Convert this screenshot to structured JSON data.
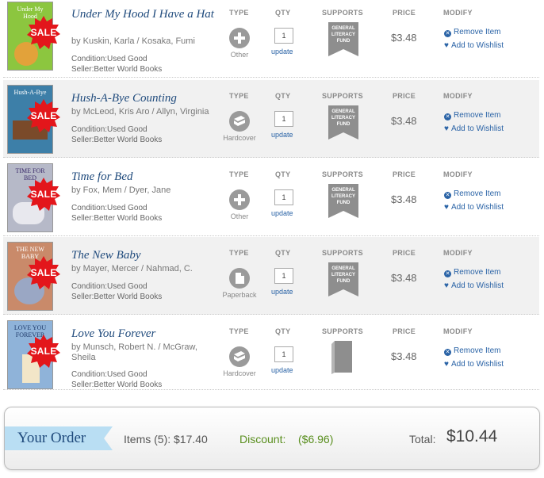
{
  "headers": {
    "type": "TYPE",
    "qty": "QTY",
    "supports": "SUPPORTS",
    "price": "PRICE",
    "modify": "MODIFY"
  },
  "sale_label": "SALE",
  "fund_label": "GENERAL LITERACY FUND",
  "update_label": "update",
  "remove_label": "Remove Item",
  "wishlist_label": "Add to Wishlist",
  "items": [
    {
      "title": "Under My Hood I Have a Hat",
      "author": "by Kuskin, Karla / Kosaka, Fumi",
      "condition": "Condition:Used Good",
      "seller": "Seller:Better World Books",
      "type": "Other",
      "qty": "1",
      "price": "$3.48",
      "cover_text": "Under My Hood",
      "cover_color": "#8cc63f"
    },
    {
      "title": "Hush-A-Bye Counting",
      "author": "by McLeod, Kris Aro / Allyn, Virginia",
      "condition": "Condition:Used Good",
      "seller": "Seller:Better World Books",
      "type": "Hardcover",
      "qty": "1",
      "price": "$3.48",
      "cover_text": "Hush-A-Bye",
      "cover_color": "#3d7fa8"
    },
    {
      "title": "Time for Bed",
      "author": "by Fox, Mem / Dyer, Jane",
      "condition": "Condition:Used Good",
      "seller": "Seller:Better World Books",
      "type": "Other",
      "qty": "1",
      "price": "$3.48",
      "cover_text": "TIME FOR BED",
      "cover_color": "#b6b9c8"
    },
    {
      "title": "The New Baby",
      "author": "by Mayer, Mercer / Nahmad, C.",
      "condition": "Condition:Used Good",
      "seller": "Seller:Better World Books",
      "type": "Paperback",
      "qty": "1",
      "price": "$3.48",
      "cover_text": "THE NEW BABY",
      "cover_color": "#c98a6a"
    },
    {
      "title": "Love You Forever",
      "author": "by Munsch, Robert N. / McGraw, Sheila",
      "condition": "Condition:Used Good",
      "seller": "Seller:Better World Books",
      "type": "Hardcover",
      "qty": "1",
      "price": "$3.48",
      "cover_text": "LOVE YOU FOREVER",
      "cover_color": "#8fb3d9"
    }
  ],
  "summary": {
    "your_order": "Your Order",
    "items": "Items (5): $17.40",
    "discount_label": "Discount:",
    "discount_value": "($6.96)",
    "total_label": "Total:",
    "total_value": "$10.44"
  },
  "colors": {
    "link": "#2a63a6",
    "title": "#1f4a7c",
    "sale": "#e3161b",
    "discount": "#5a8f1f",
    "ribbon": "#b9def3"
  }
}
